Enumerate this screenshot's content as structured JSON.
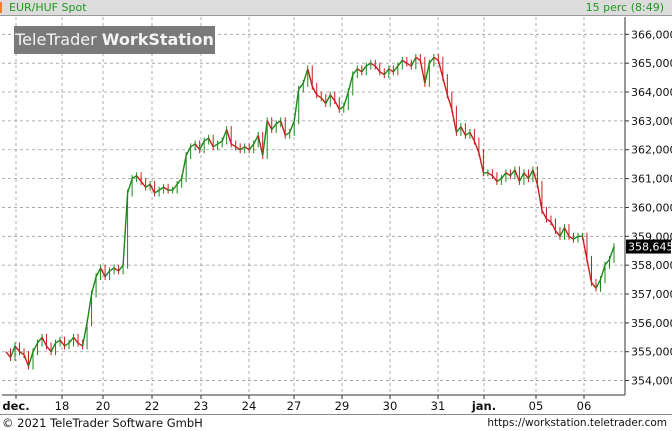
{
  "header": {
    "instrument": "EUR/HUF Spot",
    "interval": "15 perc (8:49)"
  },
  "watermark": {
    "brand": "TeleTrader",
    "product": "WorkStation"
  },
  "footer": {
    "copyright": "© 2021 TeleTrader Software GmbH",
    "url": "https://workstation.teletrader.com"
  },
  "colors": {
    "up": "#1a8a1a",
    "down": "#c81e1e",
    "grid": "#9a9a9a",
    "header_bg": "#dcdcdc",
    "header_text": "#1e9a1e",
    "last_label_bg": "#000000"
  },
  "chart_data": {
    "type": "line",
    "ylim": [
      353.5,
      366.6
    ],
    "yticks": [
      354,
      355,
      356,
      357,
      358,
      359,
      360,
      361,
      362,
      363,
      364,
      365,
      366
    ],
    "ytick_labels": [
      "354,000",
      "355,000",
      "356,000",
      "357,000",
      "358,000",
      "359,000",
      "360,000",
      "361,000",
      "362,000",
      "363,000",
      "364,000",
      "365,000",
      "366,000"
    ],
    "grid": "both-dashed",
    "x_labels": [
      "dec.",
      "18",
      "20",
      "22",
      "23",
      "24",
      "27",
      "29",
      "30",
      "31",
      "jan.",
      "05",
      "06"
    ],
    "x_label_bold": [
      true,
      false,
      false,
      false,
      false,
      false,
      false,
      false,
      false,
      false,
      true,
      false,
      false
    ],
    "last_value": 358.645,
    "last_label": "358,645",
    "series": [
      {
        "values": [
          355.0,
          354.8,
          355.2,
          355.0,
          354.9,
          354.5,
          355.0,
          355.3,
          355.5,
          355.2,
          355.0,
          355.3,
          355.4,
          355.2,
          355.3,
          355.5,
          355.3,
          355.2,
          356.0,
          357.0,
          357.6,
          357.9,
          357.6,
          357.8,
          357.9,
          357.8,
          358.0,
          360.5,
          361.0,
          361.1,
          360.9,
          360.7,
          360.8,
          360.5,
          360.6,
          360.7,
          360.6,
          360.6,
          360.8,
          361.0,
          361.8,
          362.1,
          362.2,
          362.0,
          362.3,
          362.4,
          362.1,
          362.2,
          362.3,
          362.7,
          362.2,
          362.1,
          362.0,
          362.1,
          362.0,
          362.2,
          362.5,
          361.8,
          363.0,
          362.7,
          362.9,
          363.0,
          362.5,
          362.6,
          363.0,
          364.1,
          364.3,
          364.8,
          364.2,
          363.9,
          363.8,
          363.6,
          363.9,
          363.7,
          363.4,
          363.5,
          364.0,
          364.6,
          364.8,
          364.7,
          364.9,
          365.0,
          364.9,
          364.7,
          364.6,
          364.8,
          364.7,
          364.9,
          365.1,
          365.0,
          364.9,
          365.2,
          365.1,
          364.3,
          365.0,
          365.2,
          365.1,
          364.5,
          363.9,
          363.4,
          362.6,
          362.8,
          362.5,
          362.6,
          362.3,
          361.9,
          361.2,
          361.2,
          361.1,
          360.9,
          361.0,
          361.2,
          361.1,
          361.3,
          360.9,
          361.2,
          361.0,
          361.3,
          360.8,
          359.9,
          359.6,
          359.5,
          359.2,
          359.0,
          359.3,
          359.0,
          358.9,
          359.0,
          359.0,
          358.2,
          357.4,
          357.2,
          357.5,
          358.0,
          358.2,
          358.645
        ]
      }
    ]
  }
}
